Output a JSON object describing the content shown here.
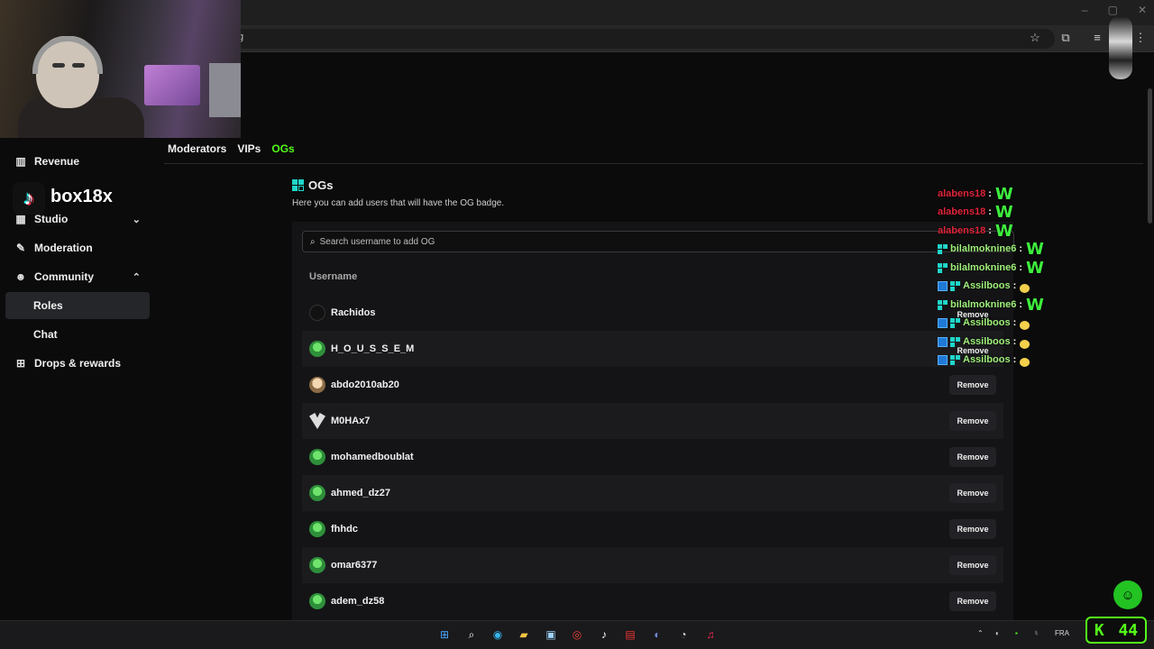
{
  "browser": {
    "url_fragment": "g",
    "window_controls": [
      "–",
      "▢",
      "✕"
    ]
  },
  "streamer": {
    "name": "box18x"
  },
  "sidebar": {
    "items": [
      {
        "label": "Revenue",
        "icon": "bar-chart-icon"
      },
      {
        "label": "Studio",
        "icon": "studio-icon"
      },
      {
        "label": "Moderation",
        "icon": "wrench-icon"
      },
      {
        "label": "Community",
        "icon": "people-icon"
      },
      {
        "label": "Roles",
        "icon": ""
      },
      {
        "label": "Chat",
        "icon": ""
      },
      {
        "label": "Drops & rewards",
        "icon": "gift-icon"
      }
    ],
    "active": "Roles"
  },
  "tabs": [
    {
      "label": "Moderators"
    },
    {
      "label": "VIPs"
    },
    {
      "label": "OGs",
      "active": true
    }
  ],
  "section": {
    "title": "OGs",
    "description": "Here you can add users that will have the OG badge.",
    "search_placeholder": "Search username to add OG",
    "column_header": "Username",
    "remove_label": "Remove"
  },
  "users": [
    {
      "name": "Rachidos",
      "avatar": "dark"
    },
    {
      "name": "H_O_U_S_S_E_M",
      "avatar": "green"
    },
    {
      "name": "abdo2010ab20",
      "avatar": "tan"
    },
    {
      "name": "M0HAx7",
      "avatar": "mask"
    },
    {
      "name": "mohamedboublat",
      "avatar": "green"
    },
    {
      "name": "ahmed_dz27",
      "avatar": "green"
    },
    {
      "name": "fhhdc",
      "avatar": "green"
    },
    {
      "name": "omar6377",
      "avatar": "green"
    },
    {
      "name": "adem_dz58",
      "avatar": "green"
    }
  ],
  "chat_overlay": [
    {
      "user": "alabens18",
      "color": "#e0243a",
      "badge": "",
      "emote": "W"
    },
    {
      "user": "alabens18",
      "color": "#e0243a",
      "badge": "",
      "emote": "W"
    },
    {
      "user": "alabens18",
      "color": "#e0243a",
      "badge": "",
      "emote": "W"
    },
    {
      "user": "bilalmoknine6",
      "color": "#9ff07a",
      "badge": "og",
      "emote": "W"
    },
    {
      "user": "bilalmoknine6",
      "color": "#9ff07a",
      "badge": "og",
      "emote": "W"
    },
    {
      "user": "Assilboos",
      "color": "#9ff07a",
      "badge": "og2",
      "emote": "smile"
    },
    {
      "user": "bilalmoknine6",
      "color": "#9ff07a",
      "badge": "og",
      "emote": "W"
    },
    {
      "user": "Assilboos",
      "color": "#9ff07a",
      "badge": "og2",
      "emote": "smile"
    },
    {
      "user": "Assilboos",
      "color": "#9ff07a",
      "badge": "og2",
      "emote": "smile"
    },
    {
      "user": "Assilboos",
      "color": "#9ff07a",
      "badge": "og2",
      "emote": "smile"
    }
  ],
  "taskbar": {
    "language": "FRA",
    "kick_counter": "44"
  },
  "colors": {
    "accent": "#53fc18",
    "og_badge": "#1fd6c9"
  }
}
